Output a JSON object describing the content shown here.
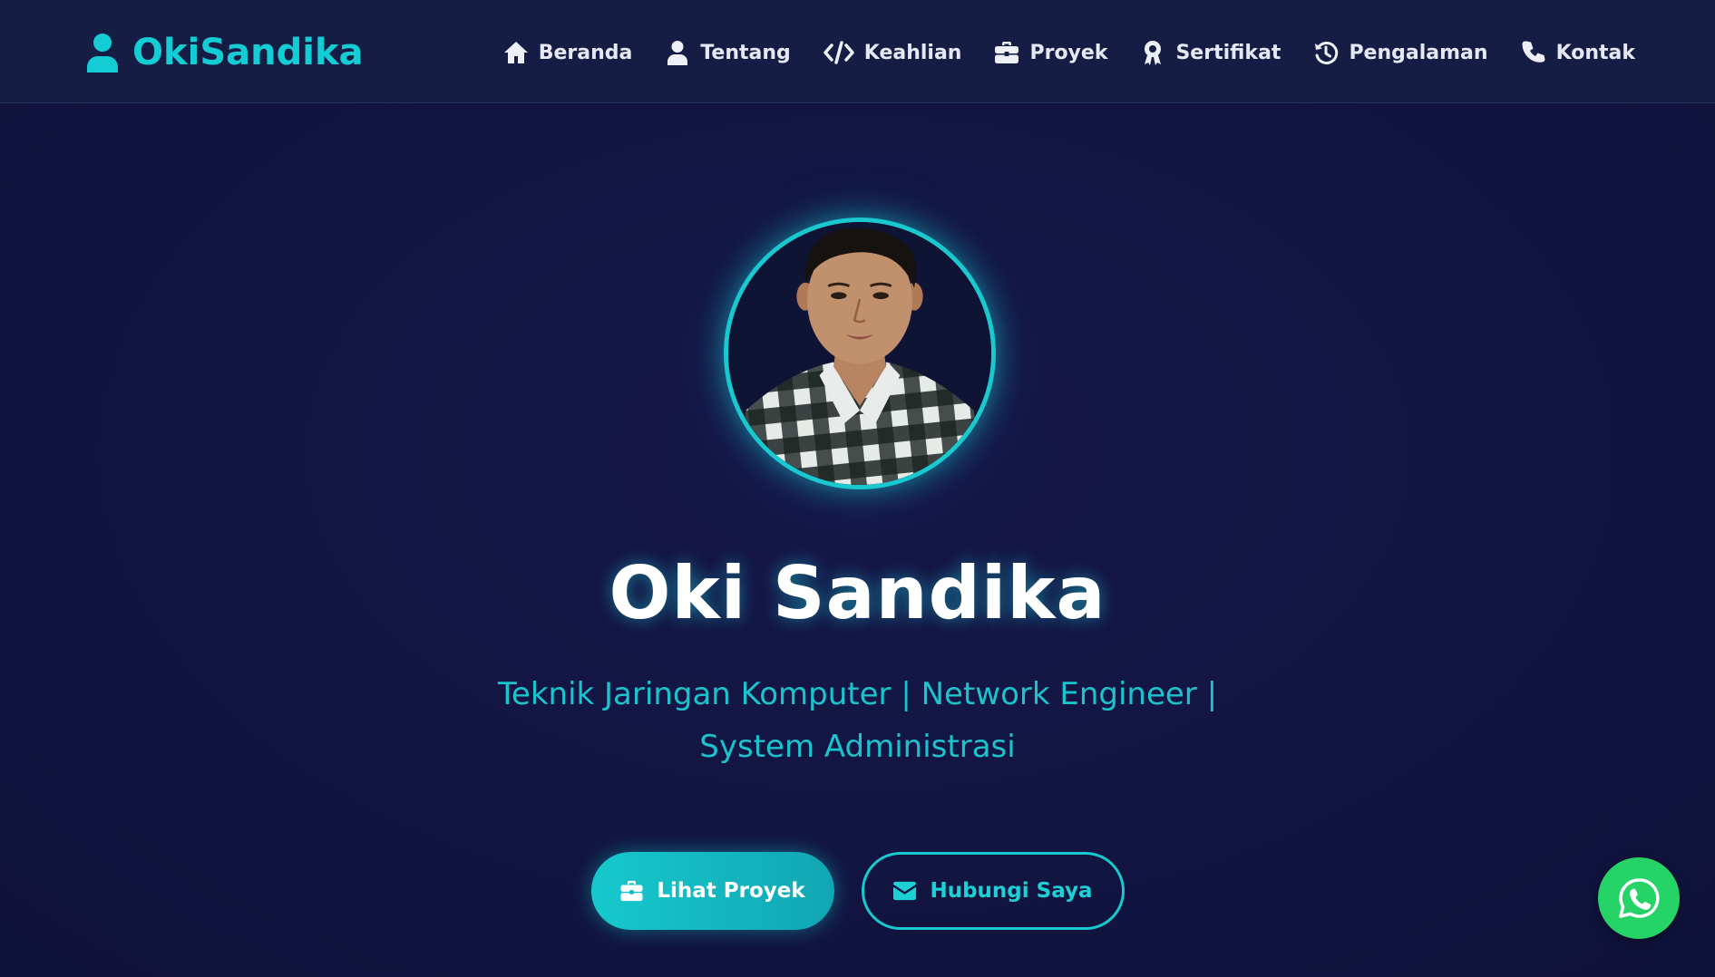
{
  "brand": {
    "name": "OkiSandika",
    "icon": "user-icon",
    "accent_color": "#14cdd4"
  },
  "nav": {
    "items": [
      {
        "label": "Beranda",
        "icon": "home-icon"
      },
      {
        "label": "Tentang",
        "icon": "user-icon"
      },
      {
        "label": "Keahlian",
        "icon": "code-icon"
      },
      {
        "label": "Proyek",
        "icon": "briefcase-icon"
      },
      {
        "label": "Sertifikat",
        "icon": "award-icon"
      },
      {
        "label": "Pengalaman",
        "icon": "history-icon"
      },
      {
        "label": "Kontak",
        "icon": "phone-icon"
      }
    ]
  },
  "hero": {
    "name": "Oki Sandika",
    "subtitle": "Teknik Jaringan Komputer | Network Engineer | System Administrasi",
    "primary_button": {
      "label": "Lihat Proyek",
      "icon": "briefcase-icon"
    },
    "secondary_button": {
      "label": "Hubungi Saya",
      "icon": "envelope-icon"
    }
  },
  "floating": {
    "whatsapp": {
      "icon": "whatsapp-icon",
      "color": "#25d366"
    }
  },
  "colors": {
    "background": "#121540",
    "navbar": "#161d45",
    "accent": "#19c9cf"
  }
}
